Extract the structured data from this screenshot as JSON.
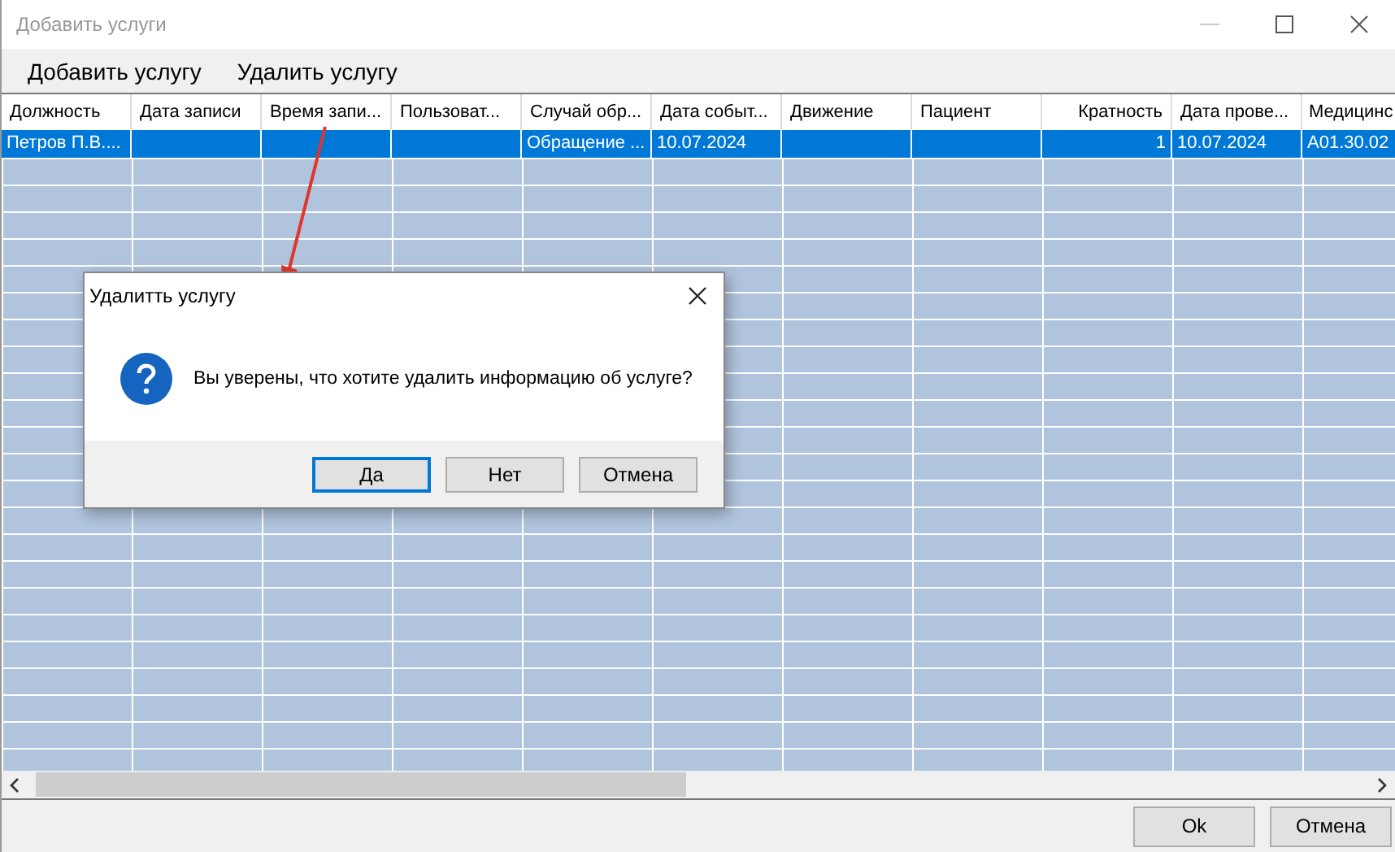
{
  "window": {
    "title": "Добавить услуги"
  },
  "menu": [
    {
      "label": "Добавить услугу"
    },
    {
      "label": "Удалить услугу"
    }
  ],
  "table": {
    "columns": [
      {
        "label": "Должность",
        "kind": "text"
      },
      {
        "label": "Дата записи",
        "kind": "text"
      },
      {
        "label": "Время запи...",
        "kind": "text"
      },
      {
        "label": "Пользоват...",
        "kind": "text"
      },
      {
        "label": "Случай обр...",
        "kind": "text"
      },
      {
        "label": "Дата событ...",
        "kind": "text"
      },
      {
        "label": "Движение",
        "kind": "text"
      },
      {
        "label": "Пациент",
        "kind": "text"
      },
      {
        "label": "Кратность",
        "kind": "number"
      },
      {
        "label": "Дата прове...",
        "kind": "text"
      },
      {
        "label": "Медицинс",
        "kind": "text"
      }
    ],
    "rows": [
      {
        "selected": true,
        "cells": [
          "Петров П.В....",
          "",
          "",
          "",
          "Обращение ...",
          "10.07.2024",
          "",
          "",
          "1",
          "10.07.2024",
          "A01.30.02"
        ]
      }
    ]
  },
  "dialog": {
    "title": "Удалитть услугу",
    "message": "Вы уверены, что хотите удалить информацию об услуге?",
    "buttons": [
      {
        "label": "Да",
        "default": true
      },
      {
        "label": "Нет",
        "default": false
      },
      {
        "label": "Отмена",
        "default": false
      }
    ]
  },
  "buttons": [
    {
      "label": "Ok"
    },
    {
      "label": "Отмена"
    }
  ]
}
